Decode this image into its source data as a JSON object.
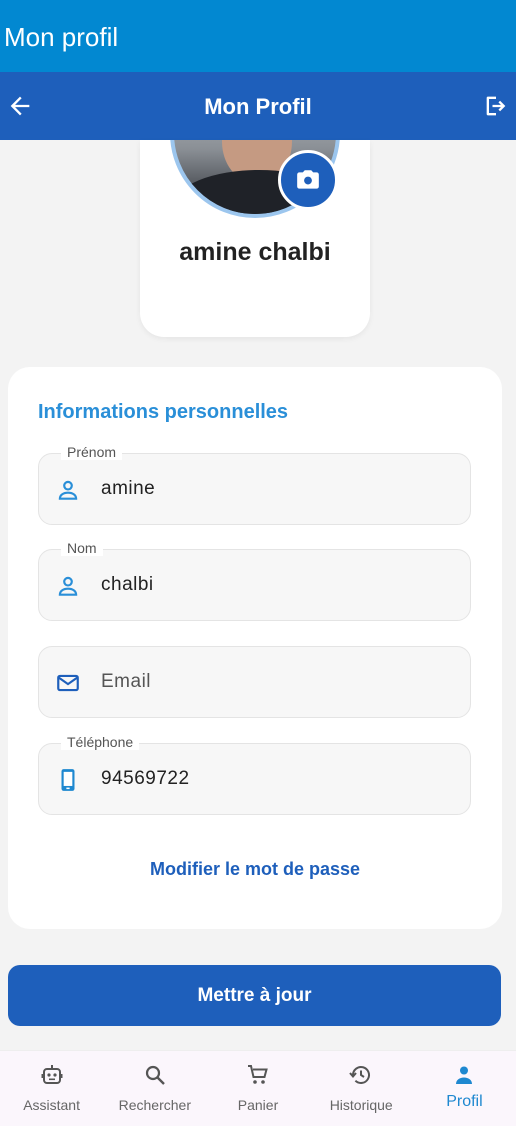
{
  "system_bar": {
    "title": "Mon profil"
  },
  "app_bar": {
    "title": "Mon Profil",
    "back_icon": "arrow-left-icon",
    "logout_icon": "logout-icon"
  },
  "profile": {
    "name": "amine chalbi",
    "camera_icon": "camera-icon"
  },
  "info": {
    "title": "Informations personnelles",
    "fields": [
      {
        "label": "Prénom",
        "value": "amine",
        "icon": "person-icon"
      },
      {
        "label": "Nom",
        "value": "chalbi",
        "icon": "person-icon"
      },
      {
        "label": "",
        "placeholder": "Email",
        "value": "",
        "icon": "mail-icon"
      },
      {
        "label": "Téléphone",
        "value": "94569722",
        "icon": "phone-icon"
      }
    ],
    "change_password": "Modifier le mot de passe"
  },
  "update_button": "Mettre à jour",
  "bottom_nav": [
    {
      "label": "Assistant",
      "icon": "robot-icon",
      "active": false
    },
    {
      "label": "Rechercher",
      "icon": "search-icon",
      "active": false
    },
    {
      "label": "Panier",
      "icon": "cart-icon",
      "active": false
    },
    {
      "label": "Historique",
      "icon": "history-icon",
      "active": false
    },
    {
      "label": "Profil",
      "icon": "person-icon",
      "active": true
    }
  ],
  "colors": {
    "status_bar": "#0288d1",
    "app_bar": "#1e5fbb",
    "accent": "#2a8fd8",
    "active_nav": "#1e88d0"
  }
}
